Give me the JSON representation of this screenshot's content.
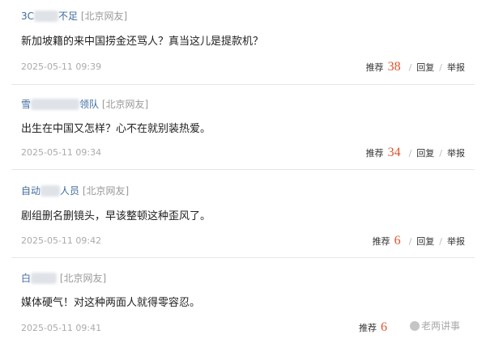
{
  "comments": [
    {
      "user_prefix": "3C",
      "user_suffix": "不足",
      "location": "[北京网友]",
      "text": "新加坡籍的来中国捞金还骂人？真当这儿是提款机？",
      "time": "2025-05-11 09:39",
      "recommend_label": "推荐",
      "count": "38",
      "reply_label": "回复",
      "report_label": "举报"
    },
    {
      "user_prefix": "雪",
      "user_suffix": "领队",
      "location": "[北京网友]",
      "text": "出生在中国又怎样？心不在就别装热爱。",
      "time": "2025-05-11 09:34",
      "recommend_label": "推荐",
      "count": "34",
      "reply_label": "回复",
      "report_label": "举报"
    },
    {
      "user_prefix": "自动",
      "user_suffix": "人员",
      "location": "[北京网友]",
      "text": "剧组删名删镜头，早该整顿这种歪风了。",
      "time": "2025-05-11 09:42",
      "recommend_label": "推荐",
      "count": "6",
      "reply_label": "回复",
      "report_label": "举报"
    },
    {
      "user_prefix": "白",
      "user_suffix": "",
      "location": "[北京网友]",
      "text": "媒体硬气！对这种两面人就得零容忍。",
      "time": "2025-05-11 09:41",
      "recommend_label": "推荐",
      "count": "6",
      "reply_label": "",
      "report_label": ""
    }
  ],
  "watermark": "老两讲事",
  "colors": {
    "username": "#3d6a9e",
    "count": "#e0522b",
    "meta": "#aaaaaa"
  }
}
